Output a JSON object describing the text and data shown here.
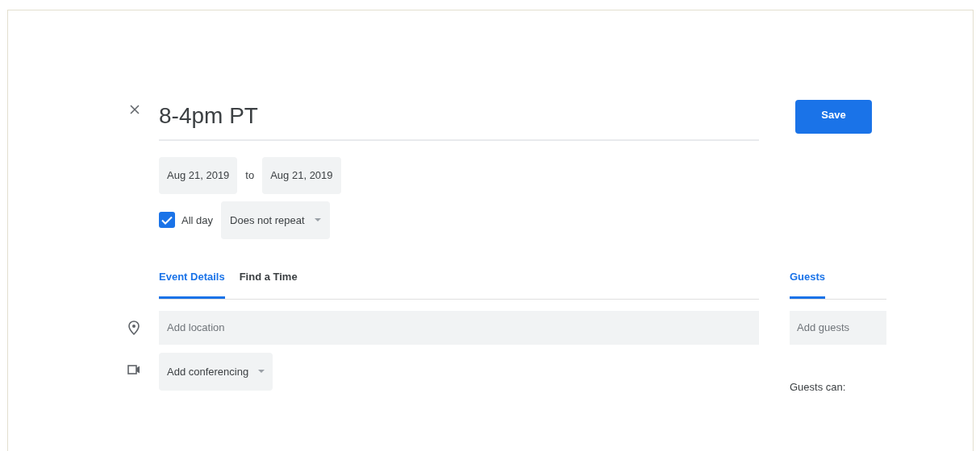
{
  "title": "8-4pm PT",
  "save": "Save",
  "start_date": "Aug 21, 2019",
  "to": "to",
  "end_date": "Aug 21, 2019",
  "all_day": {
    "label": "All day",
    "checked": true
  },
  "repeat": "Does not repeat",
  "tabs": [
    {
      "label": "Event Details",
      "selected": true
    },
    {
      "label": "Find a Time",
      "selected": false
    }
  ],
  "guests_tab": {
    "label": "Guests",
    "selected": true
  },
  "location": {
    "placeholder": "Add location"
  },
  "conferencing": "Add conferencing",
  "guests_field": {
    "placeholder": "Add guests"
  },
  "guests_can": "Guests can:"
}
